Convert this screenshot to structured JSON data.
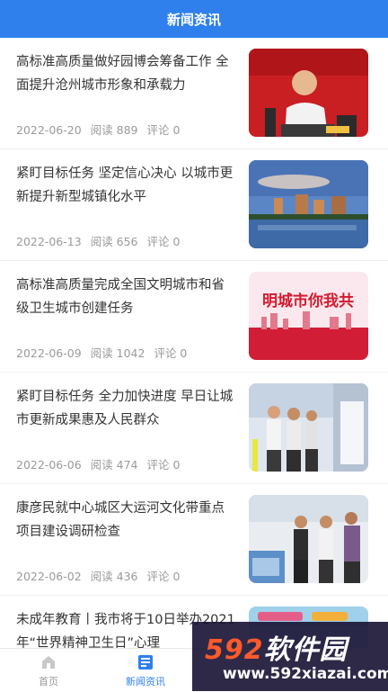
{
  "header": {
    "title": "新闻资讯"
  },
  "news": [
    {
      "title": "高标准高质量做好园博会筹备工作 全面提升沧州城市形象和承载力",
      "date": "2022-06-20",
      "reads": "阅读 889",
      "comments": "评论 0",
      "image": "official-speaking-photo"
    },
    {
      "title": "紧盯目标任务 坚定信心决心 以城市更新提升新型城镇化水平",
      "date": "2022-06-13",
      "reads": "阅读 656",
      "comments": "评论 0",
      "image": "city-skyline-photo"
    },
    {
      "title": "高标准高质量完成全国文明城市和省级卫生城市创建任务",
      "date": "2022-06-09",
      "reads": "阅读 1042",
      "comments": "评论 0",
      "image": "civilized-city-poster",
      "image_text": "明城市你我共"
    },
    {
      "title": "紧盯目标任务 全力加快进度 早日让城市更新成果惠及人民群众",
      "date": "2022-06-06",
      "reads": "阅读 474",
      "comments": "评论 0",
      "image": "site-inspection-photo"
    },
    {
      "title": "康彦民就中心城区大运河文化带重点项目建设调研检查",
      "date": "2022-06-02",
      "reads": "阅读 436",
      "comments": "评论 0",
      "image": "canal-inspection-photo"
    },
    {
      "title": "未成年教育丨我市将于10日举办2021年“世界精神卫生日”心理",
      "date": "",
      "reads": "",
      "comments": "",
      "image": "youth-poster"
    }
  ],
  "tabbar": {
    "tabs": [
      {
        "label": "首页",
        "icon": "home-icon"
      },
      {
        "label": "新闻资讯",
        "icon": "news-icon"
      }
    ]
  },
  "watermark": {
    "main_digits": "592",
    "main_text": "软件园",
    "sub": "www.592xiazai.com"
  },
  "colors": {
    "accent": "#2f80ed"
  }
}
